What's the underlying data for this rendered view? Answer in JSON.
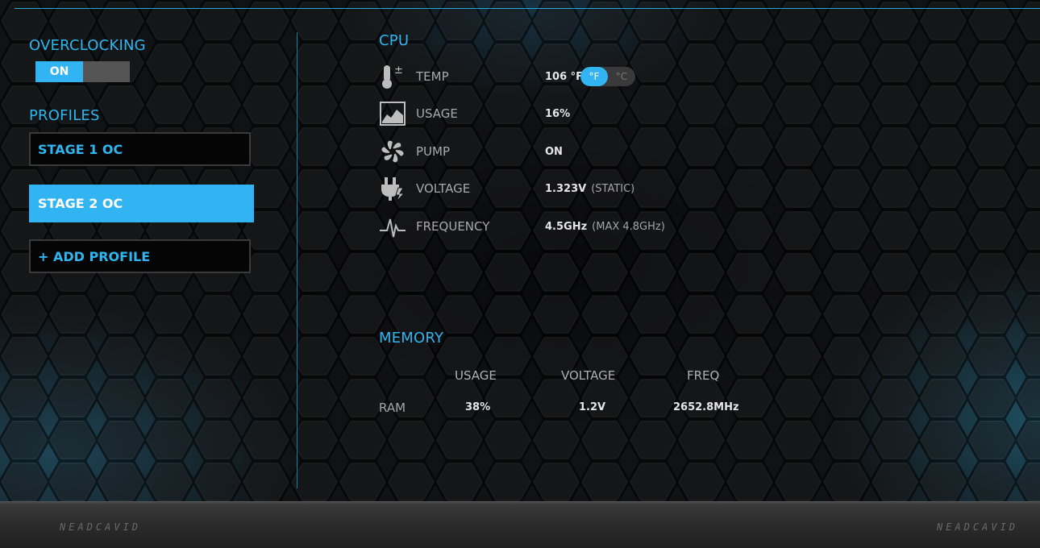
{
  "sidebar": {
    "overclocking_heading": "OVERCLOCKING",
    "overclocking_toggle": "ON",
    "profiles_heading": "PROFILES",
    "profiles": [
      "STAGE 1 OC",
      "STAGE 2 OC"
    ],
    "add_profile": "+ ADD PROFILE"
  },
  "cpu": {
    "heading": "CPU",
    "rows": [
      {
        "label": "TEMP",
        "value": "106 °F",
        "note": "",
        "icon": "thermometer-icon"
      },
      {
        "label": "USAGE",
        "value": "16%",
        "note": "",
        "icon": "usage-graph-icon"
      },
      {
        "label": "PUMP",
        "value": "ON",
        "note": "",
        "icon": "fan-icon"
      },
      {
        "label": "VOLTAGE",
        "value": "1.323V",
        "note": "(STATIC)",
        "icon": "power-plug-icon"
      },
      {
        "label": "FREQUENCY",
        "value": "4.5GHz",
        "note": "(MAX 4.8GHz)",
        "icon": "pulse-icon"
      }
    ],
    "temp_units": [
      "°F",
      "°C"
    ]
  },
  "memory": {
    "heading": "MEMORY",
    "columns": [
      "USAGE",
      "VOLTAGE",
      "FREQ"
    ],
    "row_label": "RAM",
    "values": [
      "38%",
      "1.2V",
      "2652.8MHz"
    ]
  },
  "footer": {
    "logo_left": "NEADCAVID",
    "logo_right": "NEADCAVID"
  },
  "colors": {
    "accent": "#33b4f2",
    "background": "#111214"
  }
}
